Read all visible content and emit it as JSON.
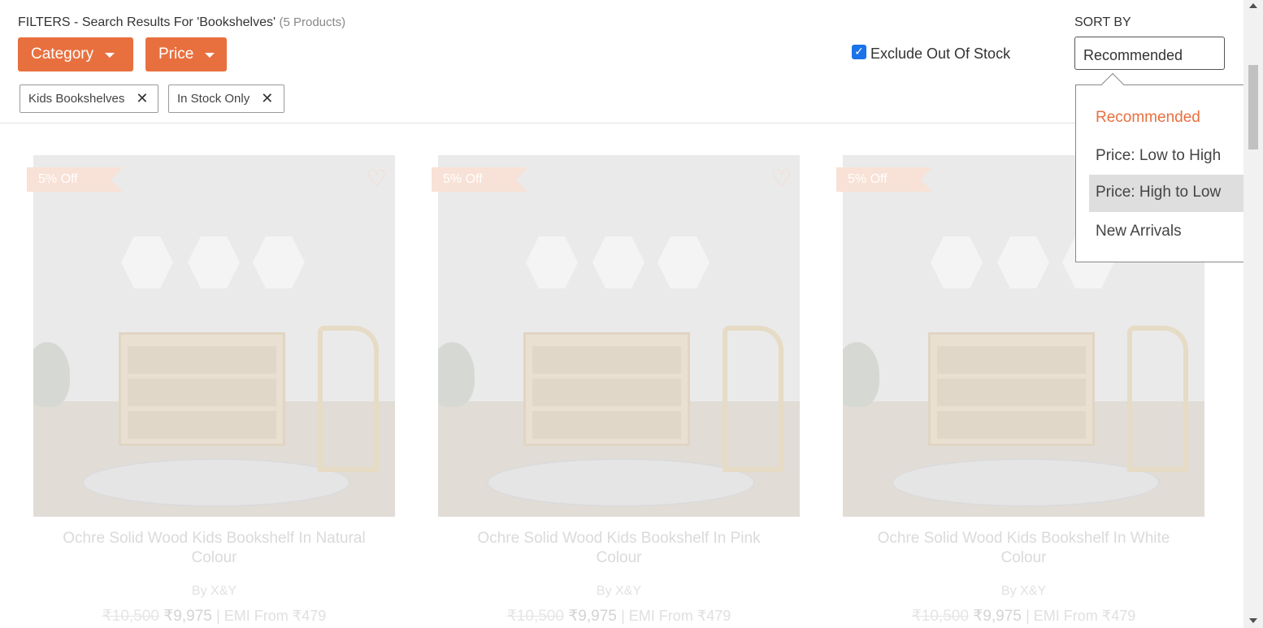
{
  "filters": {
    "title": "FILTERS - Search Results For 'Bookshelves'",
    "count": "(5 Products)",
    "buttons": [
      {
        "label": "Category"
      },
      {
        "label": "Price"
      }
    ],
    "chips": [
      {
        "label": "Kids Bookshelves"
      },
      {
        "label": "In Stock Only"
      }
    ],
    "exclude_out_of_stock": {
      "label": "Exclude Out Of Stock",
      "checked": true
    }
  },
  "sort": {
    "label": "SORT BY",
    "selected": "Recommended",
    "options": [
      {
        "label": "Recommended"
      },
      {
        "label": "Price: Low to High"
      },
      {
        "label": "Price: High to Low"
      },
      {
        "label": "New Arrivals"
      }
    ],
    "hovered_option": "Price: High to Low"
  },
  "products": [
    {
      "badge": "5% Off",
      "name": "Ochre Solid Wood Kids Bookshelf In Natural Colour",
      "brand": "By X&Y",
      "old_price": "₹10,500",
      "price": "₹9,975",
      "emi": "| EMI From ₹479"
    },
    {
      "badge": "5% Off",
      "name": "Ochre Solid Wood Kids Bookshelf In Pink Colour",
      "brand": "By X&Y",
      "old_price": "₹10,500",
      "price": "₹9,975",
      "emi": "| EMI From ₹479"
    },
    {
      "badge": "5% Off",
      "name": "Ochre Solid Wood Kids Bookshelf In White Colour",
      "brand": "By X&Y",
      "old_price": "₹10,500",
      "price": "₹9,975",
      "emi": "| EMI From ₹479"
    }
  ],
  "colors": {
    "accent": "#e8703f",
    "checkbox": "#1a73e8"
  }
}
